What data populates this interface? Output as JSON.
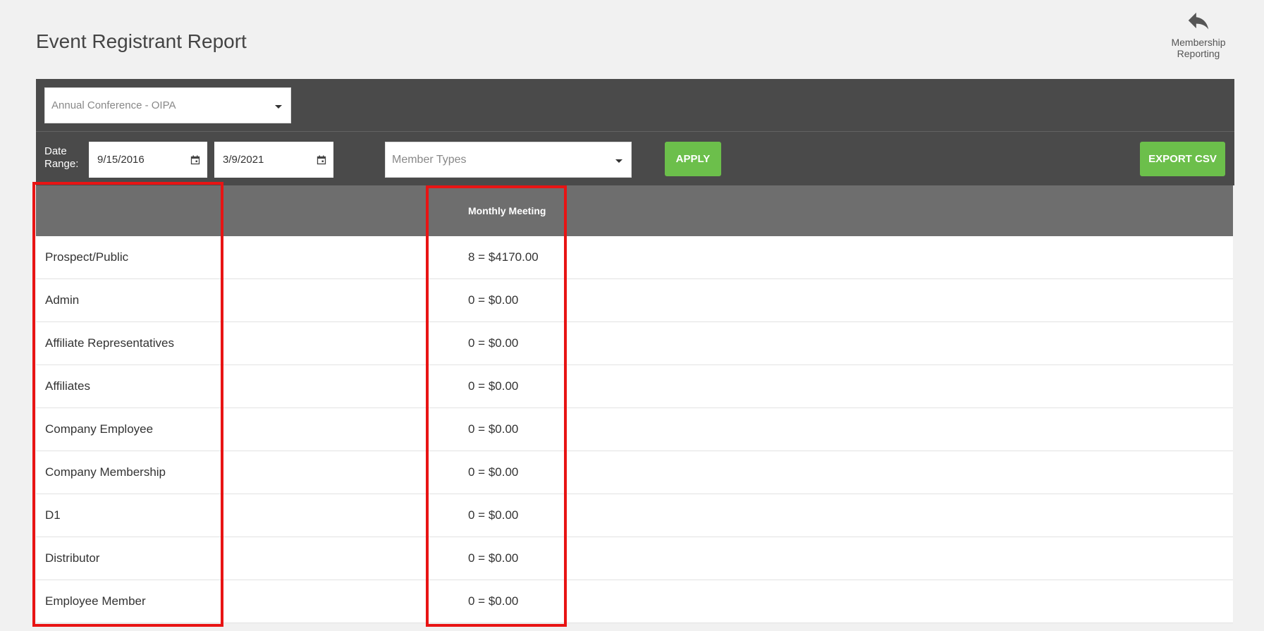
{
  "header": {
    "title": "Event Registrant Report",
    "back_link_label_line1": "Membership",
    "back_link_label_line2": "Reporting"
  },
  "filters": {
    "event_select_value": "Annual Conference - OIPA",
    "date_range_label_line1": "Date",
    "date_range_label_line2": "Range:",
    "date_start": "9/15/2016",
    "date_end": "3/9/2021",
    "member_types_placeholder": "Member Types",
    "apply_label": "APPLY",
    "export_label": "EXPORT CSV"
  },
  "table": {
    "columns": [
      "",
      "Monthly Meeting"
    ],
    "rows": [
      {
        "type": "Prospect/Public",
        "monthly_meeting": "8 = $4170.00"
      },
      {
        "type": "Admin",
        "monthly_meeting": "0 = $0.00"
      },
      {
        "type": "Affiliate Representatives",
        "monthly_meeting": "0 = $0.00"
      },
      {
        "type": "Affiliates",
        "monthly_meeting": "0 = $0.00"
      },
      {
        "type": "Company Employee",
        "monthly_meeting": "0 = $0.00"
      },
      {
        "type": "Company Membership",
        "monthly_meeting": "0 = $0.00"
      },
      {
        "type": "D1",
        "monthly_meeting": "0 = $0.00"
      },
      {
        "type": "Distributor",
        "monthly_meeting": "0 = $0.00"
      },
      {
        "type": "Employee Member",
        "monthly_meeting": "0 = $0.00"
      }
    ]
  },
  "colors": {
    "toolbar_bg": "#4a4a4a",
    "table_header_bg": "#6e6e6e",
    "button_green": "#6cbf4b",
    "highlight_red": "#e81414"
  }
}
